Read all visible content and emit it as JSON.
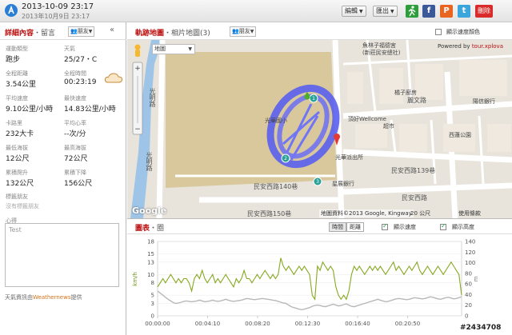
{
  "header": {
    "title": "2013-10-09 23:17",
    "subtitle": "2013年10月9日 23:17",
    "edit_label": "編輯",
    "export_label": "匯出",
    "delete_label": "刪除",
    "share_icons": [
      "run-icon",
      "facebook-icon",
      "plurk-icon",
      "twitter-icon"
    ]
  },
  "left": {
    "title": "詳細內容",
    "title_sub": "・留言",
    "friend_select": "朋友",
    "collapse_icon": "«",
    "stats": [
      {
        "label": "運動類型",
        "value": "跑步"
      },
      {
        "label": "天氣",
        "value": "25/27・C"
      },
      {
        "label": "全程距離",
        "value": "3.54公里"
      },
      {
        "label": "全程時間",
        "value": "00:23:19"
      },
      {
        "label": "平均速度",
        "value": "9.10公里/小時"
      },
      {
        "label": "最快速度",
        "value": "14.83公里/小時"
      },
      {
        "label": "卡路里",
        "value": "232大卡"
      },
      {
        "label": "平均心率",
        "value": "--次/分"
      },
      {
        "label": "最低海拔",
        "value": "12公尺"
      },
      {
        "label": "最高海拔",
        "value": "72公尺"
      },
      {
        "label": "累積爬升",
        "value": "132公尺"
      },
      {
        "label": "累積下降",
        "value": "156公尺"
      }
    ],
    "friends_label": "標籤朋友",
    "friends_empty": "沒有標籤朋友",
    "notes_label": "心得",
    "notes_value": "Test",
    "weather_credit_prefix": "天氣資訊由",
    "weather_credit_brand": "Weathernews",
    "weather_credit_suffix": "提供"
  },
  "right": {
    "title": "軌跡地圖",
    "title_sub": "・相片地圖(3)",
    "friend_select": "朋友",
    "speed_color_label": "顯示速度顏色",
    "map_type": "地圖",
    "powered_by": "Powered by",
    "powered_brand": "tour.xplova",
    "attribution": "地圖資料©2013 Google, Kingway",
    "scale_label": "20 公尺",
    "terms": "使用條款",
    "google_logo": "Google",
    "map_labels": {
      "guangming_road_1": "光明路",
      "guangming_road_2": "光明路",
      "liwen_road": "麗文路",
      "minan_w_140": "民安西路140巷",
      "minan_w_139": "民安西路139巷",
      "minan_w_150": "民安西路150巷",
      "minan_w_rd": "民安西路",
      "guanghua_elem": "光華國小",
      "guanghua_police": "光華派出所",
      "xingzhan_bank": "星展銀行",
      "wellcome": "頂好Wellcome",
      "wellcome_2": "超市",
      "xitan_park": "西蓮公園",
      "orange_shop": "橘子廚房",
      "yangjia_bank": "陽信銀行",
      "temple_1": "魚林子福德宮",
      "temple_2": "(新莊民安總社)"
    },
    "chart_title": "圖表",
    "chart_title_sub": "・圈",
    "toggle_time": "時間",
    "toggle_distance": "距離",
    "show_speed_label": "顯示速度",
    "show_altitude_label": "顯示高度"
  },
  "chart_data": {
    "type": "line",
    "title": "",
    "xlabel": "",
    "ylabel": "km/h",
    "ylabel_right": "m",
    "ylim": [
      0,
      18
    ],
    "ylim_right": [
      0,
      140
    ],
    "yticks": [
      0,
      3,
      5,
      8,
      10,
      13,
      15,
      18
    ],
    "yticks_right": [
      0,
      20,
      40,
      60,
      80,
      100,
      120,
      140
    ],
    "x_ticks": [
      "00:00:00",
      "00:04:10",
      "00:08:20",
      "00:12:30",
      "00:16:40",
      "00:20:50"
    ],
    "series": [
      {
        "color": "#86a81f",
        "values": [
          7,
          8,
          9,
          8,
          9,
          10,
          9,
          8,
          9,
          8,
          9,
          9,
          8,
          6,
          9,
          10,
          9,
          11,
          9,
          8,
          9,
          10,
          8,
          9,
          8,
          9,
          10,
          9,
          8,
          7,
          9,
          8,
          9,
          11,
          9,
          9,
          8,
          9,
          10,
          9,
          10,
          11,
          10,
          9,
          10,
          9,
          10,
          14,
          12,
          11,
          12,
          11,
          10,
          11,
          12,
          11,
          12,
          11,
          10,
          5,
          4,
          12,
          11,
          13,
          12,
          11,
          12,
          11,
          7,
          5,
          4,
          5,
          4,
          6,
          10,
          12,
          11,
          12,
          11,
          10,
          11,
          12,
          11,
          12,
          11,
          12,
          11,
          10,
          11,
          12,
          13,
          11,
          12,
          11,
          10,
          11,
          12,
          11,
          12,
          13,
          11,
          10,
          11,
          12,
          11,
          10,
          11,
          12,
          11,
          10,
          11,
          12,
          13,
          12,
          11,
          10,
          5
        ]
      },
      {
        "color": "#b8b8b8",
        "values": [
          6,
          5.5,
          5,
          4.5,
          4,
          3.6,
          3.2,
          3,
          3.1,
          3.3,
          3.5,
          3.6,
          3.5,
          3.4,
          3.5,
          3.6,
          3.8,
          3.6,
          3.4,
          3.5,
          3.6,
          3.8,
          3.6,
          3.5,
          3.6,
          3.8,
          4,
          3.8,
          3.6,
          3.5,
          3.6,
          3.7,
          3.8,
          4,
          4.2,
          4.1,
          4,
          3.9,
          4,
          4.1,
          4.2,
          4.1,
          4,
          3.9,
          3.8,
          3.7,
          3.5,
          3.3,
          3.1,
          3,
          2.6,
          2.2,
          2,
          1.8,
          1.6,
          1.5,
          1.6,
          1.8,
          2,
          2.3,
          2.5,
          2.6,
          2.5,
          2.3,
          2.2,
          2.4,
          2.6,
          2.8,
          2.6,
          2.4,
          2.5,
          2.7,
          2.9,
          2.6,
          2.3,
          2.2,
          2.4,
          2.6,
          2.8,
          3,
          3.2,
          3.4,
          3.6,
          3.8,
          4,
          3.8,
          3.6,
          3.4,
          3.5,
          3.7,
          3.9,
          4.1,
          4.2,
          4.1,
          4,
          3.9,
          4,
          4.2,
          4.4,
          4.3,
          4.2,
          4.1,
          4.2,
          4.4,
          4.6,
          4.5,
          4.3,
          4.1,
          4,
          4.2,
          4.4,
          4.5,
          4.3,
          4.1,
          4.2,
          4.4,
          4.6
        ]
      }
    ]
  },
  "watermark": "#2434708"
}
